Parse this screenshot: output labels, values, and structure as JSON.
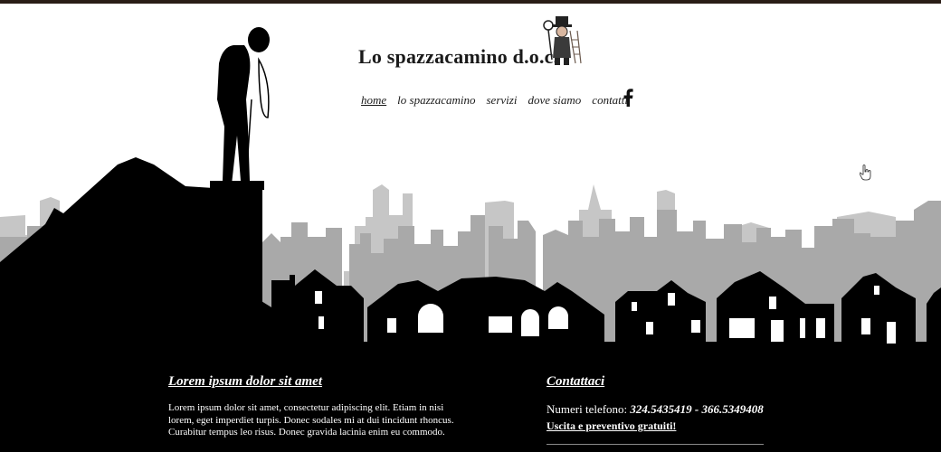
{
  "header": {
    "site_title": "Lo spazzacamino d.o.c.",
    "logo_icon": "chimney-sweep-logo-icon"
  },
  "nav": {
    "items": [
      {
        "label": "home",
        "active": true
      },
      {
        "label": "lo spazzacamino",
        "active": false
      },
      {
        "label": "servizi",
        "active": false
      },
      {
        "label": "dove siamo",
        "active": false
      },
      {
        "label": "contatti",
        "active": false
      }
    ],
    "facebook_icon": "facebook-icon"
  },
  "about": {
    "heading": "Lorem ipsum dolor sit amet",
    "text": "Lorem ipsum dolor sit amet, consectetur adipiscing elit. Etiam in nisi lorem, eget imperdiet turpis. Donec sodales mi at dui tincidunt rhoncus. Curabitur tempus leo risus. Donec gravida lacinia enim eu commodo."
  },
  "contact": {
    "heading": "Contattaci",
    "phone_label": "Numeri telefono:",
    "phone_numbers": "324.5435419 - 366.5349408",
    "promo": "Uscita e preventivo gratuiti!"
  },
  "colors": {
    "background": "#ffffff",
    "silhouette": "#000000",
    "skyline_far": "#a8a8a8",
    "skyline_mid": "#c4c4c4",
    "top_border": "#2a1d16"
  }
}
